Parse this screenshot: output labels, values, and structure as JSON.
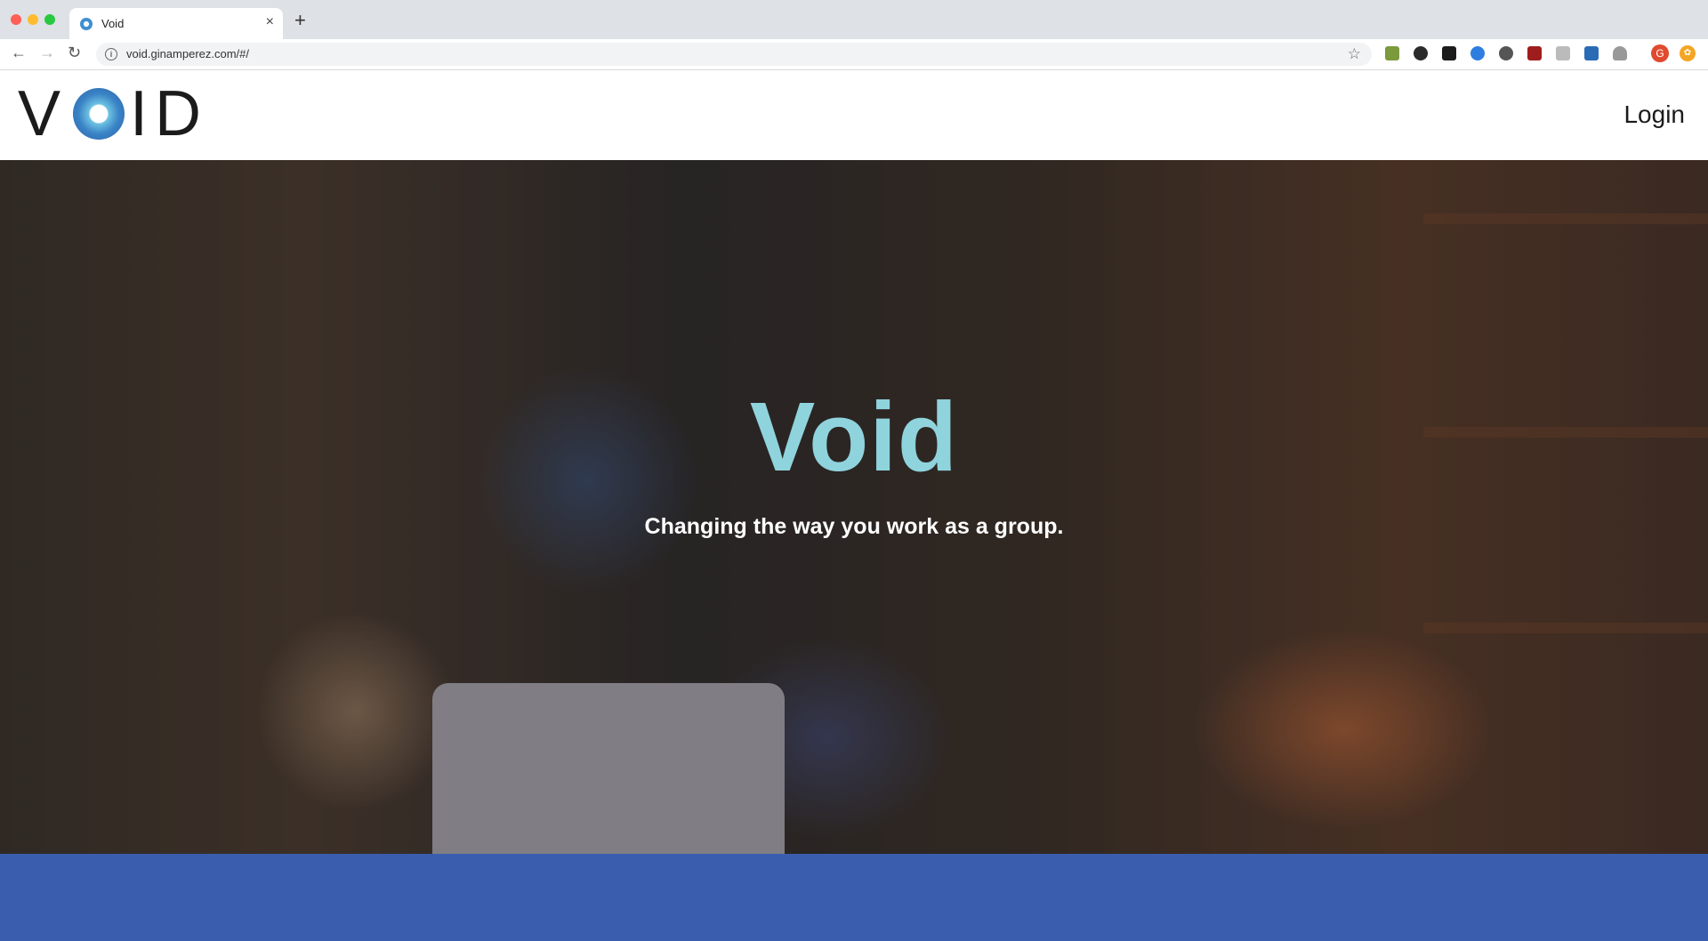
{
  "browser": {
    "tab_title": "Void",
    "tab_close": "×",
    "new_tab": "+",
    "url": "void.ginamperez.com/#/",
    "profile_initial": "G"
  },
  "header": {
    "logo_text_left": "V",
    "logo_text_right": "ID",
    "login_label": "Login"
  },
  "hero": {
    "title": "Void",
    "subtitle": "Changing the way you work as a group."
  },
  "colors": {
    "hero_title": "#8fd3dd",
    "band": "#3a5dae"
  }
}
